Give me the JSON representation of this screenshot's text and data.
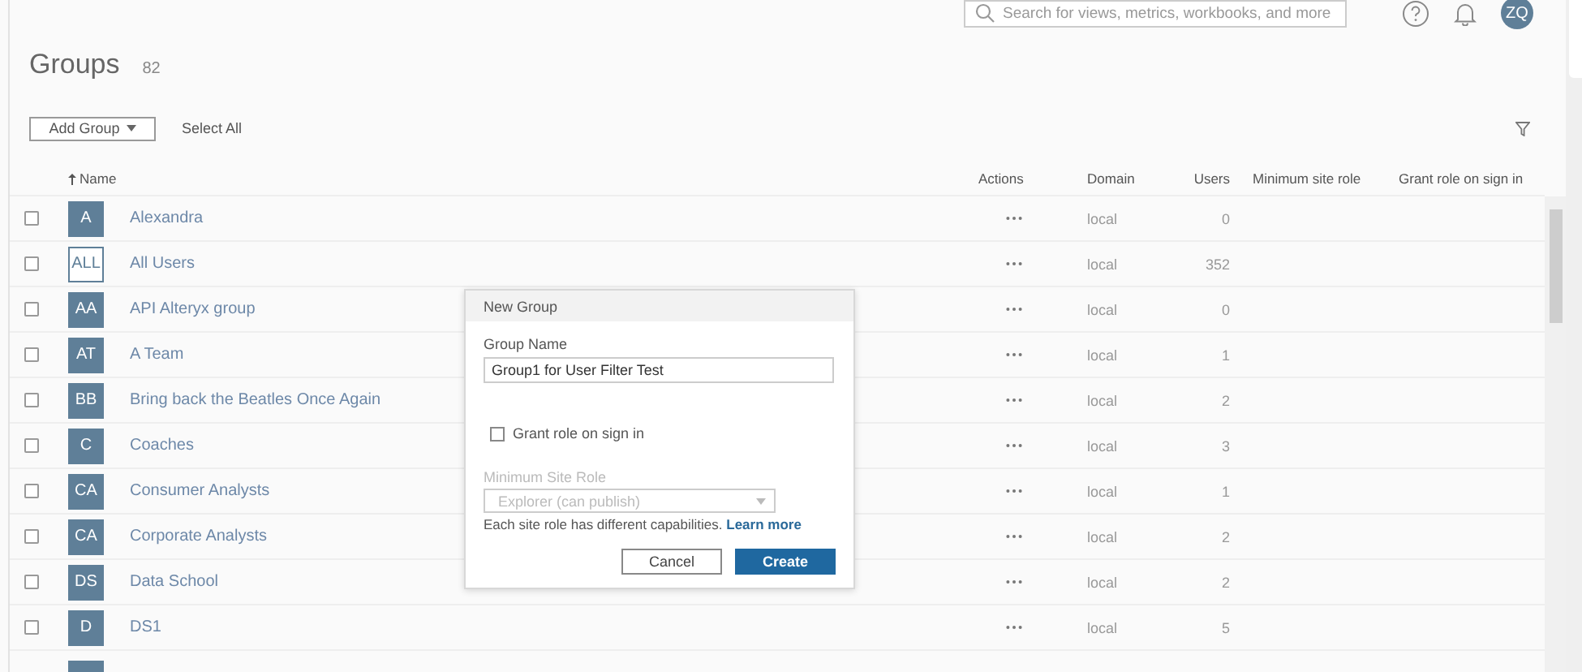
{
  "top_bar": {
    "search": {
      "placeholder": "Search for views, metrics, workbooks, and more"
    },
    "user_initials": "ZQ"
  },
  "page": {
    "title": "Groups",
    "count": "82"
  },
  "toolbar": {
    "add_button": "Add Group",
    "select_all": "Select All"
  },
  "table": {
    "columns": [
      {
        "label": "Name",
        "sorted": true
      },
      {
        "label": "Actions",
        "sorted": false
      },
      {
        "label": "Domain",
        "sorted": false
      },
      {
        "label": "Users",
        "sorted": false
      },
      {
        "label": "Minimum site role",
        "sorted": false
      },
      {
        "label": "Grant role on sign in",
        "sorted": false
      }
    ],
    "rows": [
      {
        "kind": "group",
        "checked": false,
        "initials": "A",
        "name": "Alexandra",
        "domain": "local",
        "users": "0"
      },
      {
        "kind": "all",
        "checked": false,
        "initials": "ALL",
        "name": "All Users",
        "domain": "local",
        "users": "352"
      },
      {
        "kind": "group",
        "checked": false,
        "initials": "AA",
        "name": "API Alteryx group",
        "domain": "local",
        "users": "0"
      },
      {
        "kind": "group",
        "checked": false,
        "initials": "AT",
        "name": "A Team",
        "domain": "local",
        "users": "1"
      },
      {
        "kind": "group",
        "checked": false,
        "initials": "BB",
        "name": "Bring back the Beatles Once Again",
        "domain": "local",
        "users": "2"
      },
      {
        "kind": "group",
        "checked": false,
        "initials": "C",
        "name": "Coaches",
        "domain": "local",
        "users": "3"
      },
      {
        "kind": "group",
        "checked": false,
        "initials": "CA",
        "name": "Consumer Analysts",
        "domain": "local",
        "users": "1"
      },
      {
        "kind": "group",
        "checked": false,
        "initials": "CA",
        "name": "Corporate Analysts",
        "domain": "local",
        "users": "2"
      },
      {
        "kind": "group",
        "checked": false,
        "initials": "DS",
        "name": "Data School",
        "domain": "local",
        "users": "2"
      },
      {
        "kind": "group",
        "checked": false,
        "initials": "D",
        "name": "DS1",
        "domain": "local",
        "users": "5"
      },
      {
        "kind": "cut"
      }
    ]
  },
  "dialog": {
    "title": "New Group",
    "name_label": "Group Name",
    "name_value": "Group1 for User Filter Test",
    "grant": {
      "label": "Grant role on sign in",
      "checked": false
    },
    "role_label": "Minimum Site Role",
    "role_value": "Explorer (can publish)",
    "role_disabled": true,
    "help": "Each site role has different capabilities.",
    "help_link": "Learn more",
    "buttons": [
      {
        "label": "Cancel",
        "kind": "secondary"
      },
      {
        "label": "Create",
        "kind": "primary"
      }
    ]
  }
}
